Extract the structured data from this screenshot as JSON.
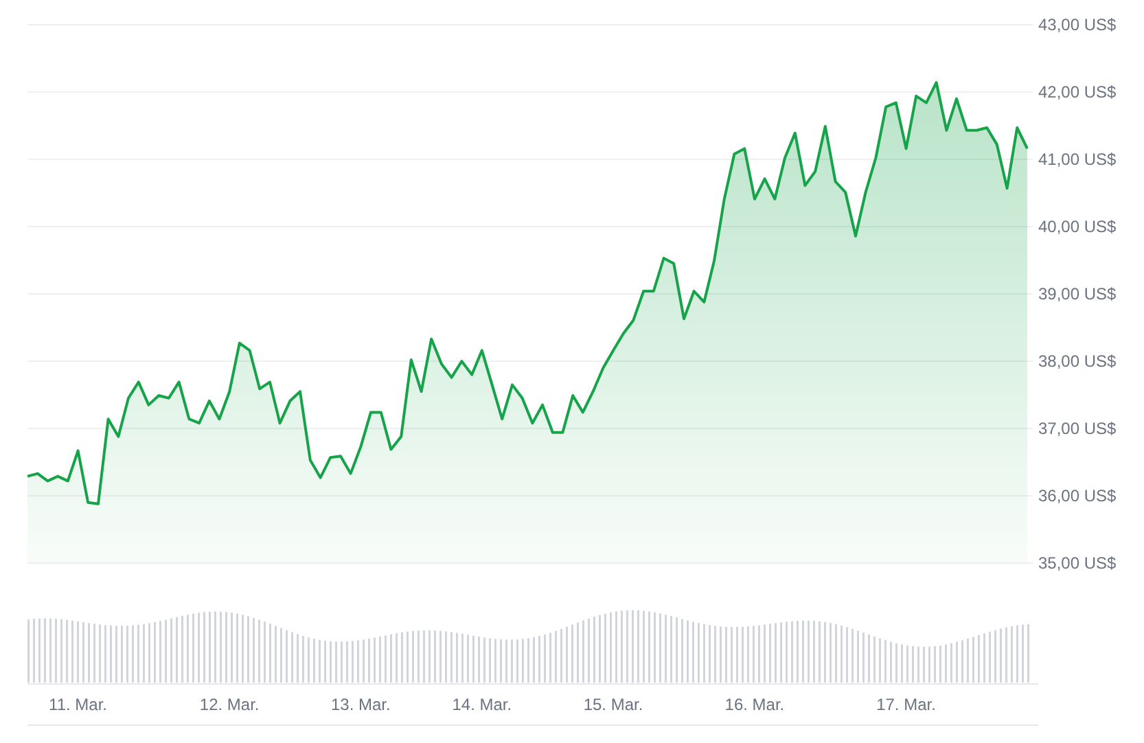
{
  "chart": {
    "chart_data": {
      "type": "area",
      "grid": true,
      "ylim": [
        35,
        43
      ],
      "categories": [
        null,
        null,
        null,
        null,
        null,
        "11. Mar.",
        null,
        null,
        null,
        null,
        null,
        null,
        null,
        null,
        null,
        null,
        null,
        null,
        null,
        null,
        "12. Mar.",
        null,
        null,
        null,
        null,
        null,
        null,
        null,
        null,
        null,
        null,
        null,
        null,
        "13. Mar.",
        null,
        null,
        null,
        null,
        null,
        null,
        null,
        null,
        null,
        null,
        null,
        "14. Mar.",
        null,
        null,
        null,
        null,
        null,
        null,
        null,
        null,
        null,
        null,
        null,
        null,
        "15. Mar.",
        null,
        null,
        null,
        null,
        null,
        null,
        null,
        null,
        null,
        null,
        null,
        null,
        null,
        "16. Mar.",
        null,
        null,
        null,
        null,
        null,
        null,
        null,
        null,
        null,
        null,
        null,
        null,
        null,
        null,
        "17. Mar.",
        null,
        null,
        null,
        null,
        null,
        null,
        null,
        null,
        null,
        null,
        null,
        null
      ],
      "yticks": [
        {
          "value": 35,
          "label": "35,00 US$"
        },
        {
          "value": 36,
          "label": "36,00 US$"
        },
        {
          "value": 37,
          "label": "37,00 US$"
        },
        {
          "value": 38,
          "label": "38,00 US$"
        },
        {
          "value": 39,
          "label": "39,00 US$"
        },
        {
          "value": 40,
          "label": "40,00 US$"
        },
        {
          "value": 41,
          "label": "41,00 US$"
        },
        {
          "value": 42,
          "label": "42,00 US$"
        },
        {
          "value": 43,
          "label": "43,00 US$"
        }
      ],
      "series": [
        {
          "color": "#16a34a",
          "values": [
            36.29,
            36.33,
            36.22,
            36.29,
            36.22,
            36.67,
            35.9,
            35.88,
            37.14,
            36.88,
            37.45,
            37.69,
            37.35,
            37.49,
            37.45,
            37.69,
            37.14,
            37.08,
            37.41,
            37.14,
            37.55,
            38.27,
            38.16,
            37.59,
            37.69,
            37.08,
            37.41,
            37.55,
            36.53,
            36.27,
            36.57,
            36.59,
            36.33,
            36.73,
            37.24,
            37.24,
            36.69,
            36.88,
            38.02,
            37.55,
            38.33,
            37.96,
            37.76,
            38.0,
            37.8,
            38.16,
            37.65,
            37.14,
            37.65,
            37.45,
            37.08,
            37.35,
            36.94,
            36.94,
            37.49,
            37.24,
            37.55,
            37.9,
            38.16,
            38.41,
            38.61,
            39.04,
            39.04,
            39.53,
            39.45,
            38.63,
            39.04,
            38.88,
            39.49,
            40.41,
            41.08,
            41.16,
            40.41,
            40.71,
            40.41,
            41.02,
            41.39,
            40.61,
            40.82,
            41.49,
            40.67,
            40.51,
            39.86,
            40.51,
            41.02,
            41.78,
            41.84,
            41.16,
            41.94,
            41.84,
            42.14,
            41.43,
            41.9,
            41.43,
            41.43,
            41.47,
            41.22,
            40.57,
            41.47,
            41.16
          ]
        }
      ]
    }
  }
}
